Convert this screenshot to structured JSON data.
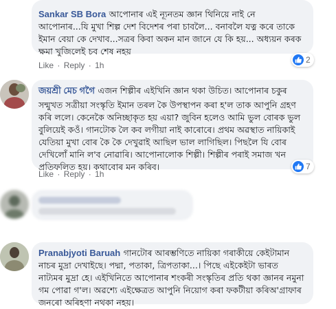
{
  "comments": [
    {
      "author": "Sankar SB Bora",
      "text": "আপোনাৰ এই ন্যূনতম জ্ঞান থিনিয়ে নাই নে আপোনাৰ...যি মুখা শিল্প দেশ বিদেশৰ পৰা চাবলৈ... বনাবলৈ যত্ন কৰে তাকে ইমান বেয়া কে দেখাব...সত্ৰৰ কিবা অকন মান জানে যে কি হয়... অধ্যয়ন কৰক ক্ষমা খুজিলেই চব শেষ নহয়",
      "like_label": "Like",
      "reply_label": "Reply",
      "time": "1h",
      "reaction_count": "2"
    },
    {
      "author": "জয়শ্ৰী মেচ গগৈ",
      "text": "এজন শিল্পীৰ এইখিনি জ্ঞান থকা উচিত। আপোনাৰ চকুৰ সন্মুখত সত্ৰীয়া সংস্কৃতি ইমান তৰল কৈ উপস্থাপন কৰা হ'ল তাক আপুনি গ্ৰহণ কৰি ললে। কেনেকৈ অনিচ্ছাকৃত হয় এয়া? জুবিন হলেও আমি ভুল বোৰক ভুল বুলিয়েই কওঁ। গানটোক লৈ কব লগীয়া নাই কাৰোৰে। প্ৰথম অৱস্থাত নায়িকাই যেতিয়া মুখা বোৰ কৈ কৈ দেখুৱাই আছিল ভাল লাগিছিল। পিছলৈ যি বোৰ দেখিলোঁ মানি ল'ব নোৱাৰি। আপোনালোক শিল্পী। শিল্পীৰ পৰাই সমাজ খন প্ৰতিফলিত হয়। কথাবোৰ মন কৰিব।",
      "like_label": "Like",
      "reply_label": "Reply",
      "time": "1h",
      "reaction_count": "7"
    },
    {
      "author": "Pranabjyoti Baruah",
      "text": "গানটোৰ আৰম্ভণিতে নায়িকা গৰাকীয়ে কেইটামান নাচৰ মুদ্ৰা দেখাইছে। পদ্মা, পতাকা, ত্ৰিপতাকা...। পিছে এইকেইটা ভাৰত নাট্যমৰ মুদ্ৰা হে। এইখিনিতে আপোনাৰ শংকৰী সংস্কৃতিৰ প্ৰতি থকা জ্ঞানৰ নমুনা গম পোৱা গ'ল। অৱশ্যে এইক্ষেত্ৰত আপুনি নিয়োগ কৰা ফকটীয়া কৰিঅ'গ্ৰাফাৰ জনৰো অৰিহণা নথকা নহয়।"
    }
  ],
  "colors": {
    "accent": "#385898",
    "bubble": "#f0f2f5",
    "like": "#2078f4",
    "meta": "#65676b"
  }
}
